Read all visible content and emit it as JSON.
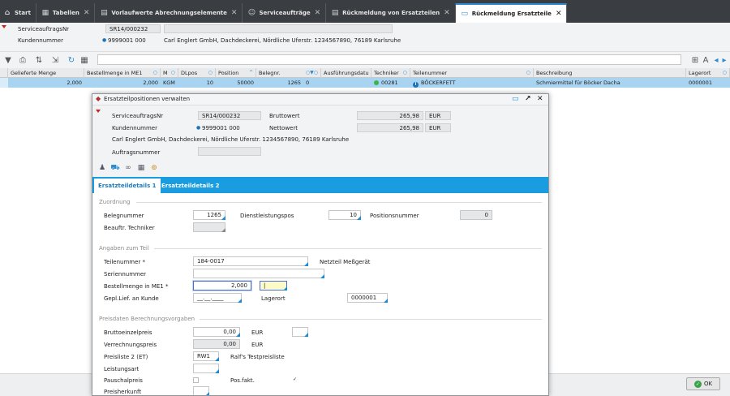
{
  "tabs": [
    {
      "label": "Start",
      "icon": "home-icon",
      "closable": false
    },
    {
      "label": "Tabellen",
      "icon": "table-icon",
      "closable": true
    },
    {
      "label": "Vorlaufwerte Abrechnungselemente",
      "icon": "grid-icon",
      "closable": true
    },
    {
      "label": "Serviceaufträge",
      "icon": "user-icon",
      "closable": true
    },
    {
      "label": "Rückmeldung von Ersatzteilen",
      "icon": "grid-icon",
      "closable": true
    },
    {
      "label": "Rückmeldung Ersatzteile",
      "icon": "window-icon",
      "closable": true
    }
  ],
  "header": {
    "auftrag_label": "ServiceauftragsNr",
    "auftrag_value": "SR14/000232",
    "kunde_label": "Kundennummer",
    "kunde_value": "9999001 000",
    "kunde_name": "Carl Englert GmbH, Dachdeckerei, Nördliche Uferstr. 1234567890, 76189 Karlsruhe"
  },
  "grid": {
    "columns": [
      "Gelieferte Menge",
      "Bestellmenge in ME1",
      "M",
      "DLpos",
      "Position",
      "Belegnr.",
      "Ausführungsdatu",
      "Techniker",
      "Teilenummer",
      "Beschreibung",
      "Lagerort"
    ],
    "row": {
      "gelieferte_menge": "2,000",
      "bestellmenge": "2,000",
      "me": "KGM",
      "dlpos": "10",
      "position": "50000",
      "belegnr": "1265",
      "belegnr_extra": "0",
      "ausfuehrung": "",
      "techniker": "00281",
      "teilenummer": "BÖCKERFETT",
      "beschreibung": "Schmiermittel für Böcker Dacha",
      "lagerort": "0000001"
    }
  },
  "ok_label": "OK",
  "modal": {
    "title": "Ersatzteilpositionen verwalten",
    "auftrag_label": "ServiceauftragsNr",
    "auftrag_value": "SR14/000232",
    "kunde_label": "Kundennummer",
    "kunde_value": "9999001 000",
    "kunde_name": "Carl Englert GmbH, Dachdeckerei, Nördliche Uferstr. 1234567890, 76189 Karlsruhe",
    "auftragsnummer_label": "Auftragsnummer",
    "auftragsnummer_value": "",
    "brutto_label": "Bruttowert",
    "brutto_value": "265,98",
    "brutto_cur": "EUR",
    "netto_label": "Nettowert",
    "netto_value": "265,98",
    "netto_cur": "EUR",
    "tab1": "Ersatzteildetails 1",
    "tab2": "Ersatzteildetails 2",
    "zuordnung": {
      "title": "Zuordnung",
      "belegnummer_label": "Belegnummer",
      "belegnummer_value": "1265",
      "dienstpos_label": "Dienstleistungspos",
      "dienstpos_value": "10",
      "positionsnr_label": "Positionsnummer",
      "positionsnr_value": "0",
      "techniker_label": "Beauftr. Techniker",
      "techniker_value": ""
    },
    "teil": {
      "title": "Angaben zum Teil",
      "teilenummer_label": "Teilenummer *",
      "teilenummer_value": "184-0017",
      "teil_bezeichnung": "Netzteil Meßgerät",
      "seriennummer_label": "Seriennummer",
      "seriennummer_value": "",
      "bestellmenge_label": "Bestellmenge in ME1 *",
      "bestellmenge_value": "2,000",
      "me_value": "|",
      "gepl_label": "Gepl.Lief. an Kunde",
      "gepl_value": "__.__.____",
      "lagerort_label": "Lagerort",
      "lagerort_value": "0000001"
    },
    "preis": {
      "title": "Preisdaten Berechnungsvorgaben",
      "brutto_label": "Bruttoeinzelpreis",
      "brutto_value": "0,00",
      "brutto_cur": "EUR",
      "verrechnung_label": "Verrechnungspreis",
      "verrechnung_value": "0,00",
      "verrechnung_cur": "EUR",
      "preisliste_label": "Preisliste 2 (ET)",
      "preisliste_value": "RW1",
      "preisliste_name": "Ralf's Testpreisliste",
      "leistungsart_label": "Leistungsart",
      "pauschal_label": "Pauschalpreis",
      "posfakt_label": "Pos.fakt.",
      "posfakt_checked": "✓",
      "herkunft_label": "Preisherkunft"
    }
  }
}
